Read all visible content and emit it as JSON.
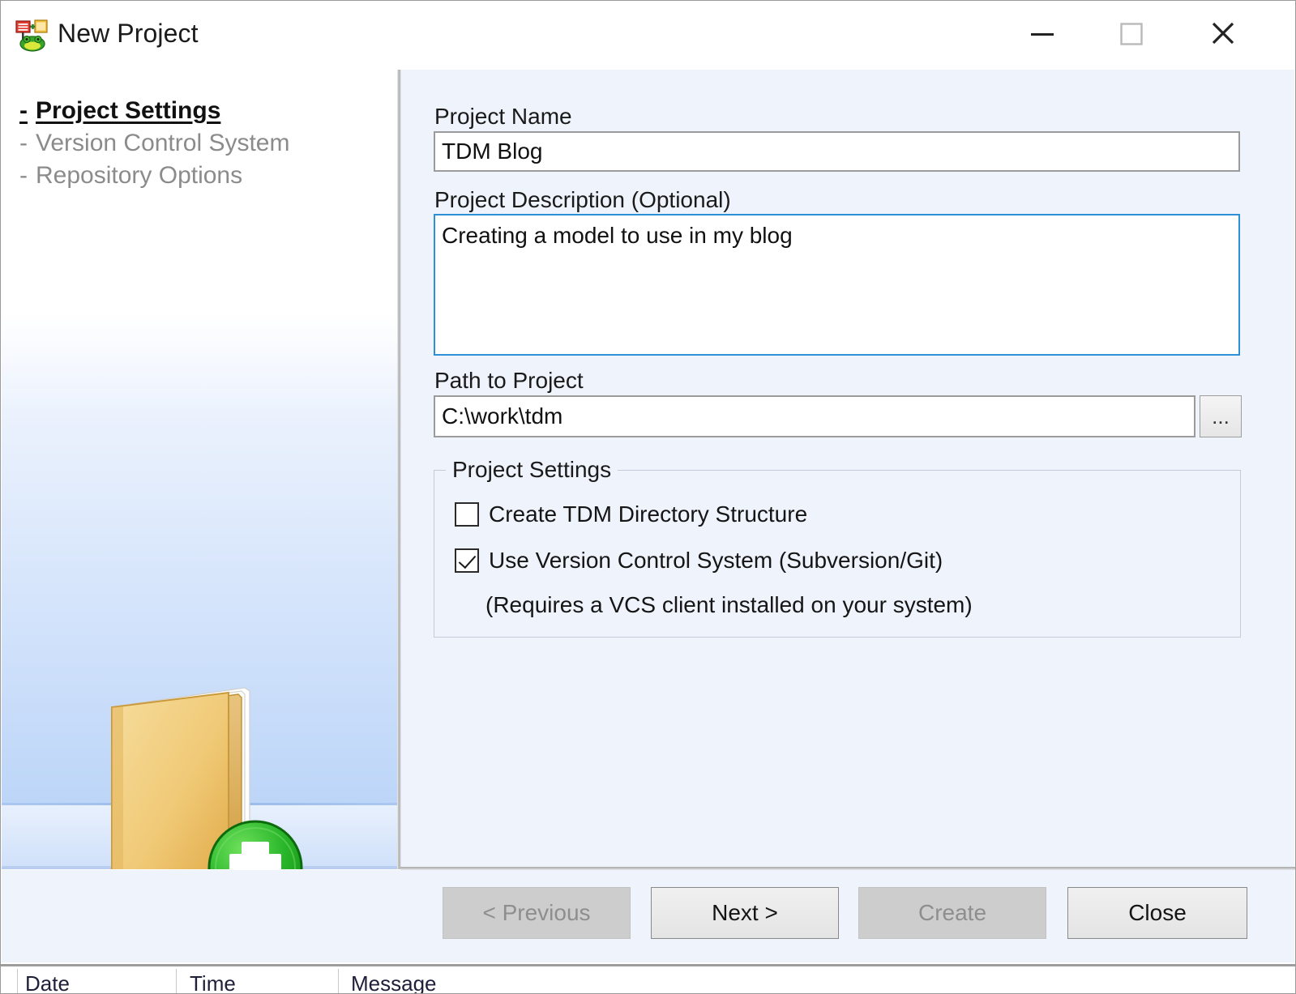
{
  "window": {
    "title": "New Project",
    "icon": "new-project-icon",
    "controls": {
      "minimize": "minimize-icon",
      "maximize": "maximize-icon",
      "close": "close-icon"
    }
  },
  "sidebar": {
    "items": [
      {
        "label": "- Project Settings",
        "dash": "-",
        "text": "Project Settings",
        "active": true
      },
      {
        "label": "- Version Control System",
        "dash": "-",
        "text": "Version Control System",
        "active": false
      },
      {
        "label": "- Repository Options",
        "dash": "-",
        "text": "Repository Options",
        "active": false
      }
    ],
    "illustration": "new-folder-icon"
  },
  "form": {
    "name_label": "Project Name",
    "name_value": "TDM Blog",
    "name_placeholder": "",
    "description_label": "Project Description (Optional)",
    "description_value": "Creating a model to use in my blog",
    "description_placeholder": "",
    "path_label": "Path to Project",
    "path_value": "C:\\work\\tdm",
    "path_placeholder": "",
    "browse_label": "...",
    "group": {
      "title": "Project Settings",
      "checkboxes": [
        {
          "label": "Create TDM Directory Structure",
          "checked": false
        },
        {
          "label": "Use Version Control System (Subversion/Git)",
          "checked": true
        }
      ],
      "note": "(Requires a VCS client installed on your system)"
    }
  },
  "footer": {
    "buttons": [
      {
        "label": "< Previous",
        "enabled": false
      },
      {
        "label": "Next >",
        "enabled": true
      },
      {
        "label": "Create",
        "enabled": false
      },
      {
        "label": "Close",
        "enabled": true
      }
    ]
  },
  "log_table": {
    "columns": [
      "Date",
      "Time",
      "Message"
    ]
  },
  "colors": {
    "pane_background": "#eef3fc",
    "focus_border": "#2d8fd5",
    "accent_green": "#2eb82e",
    "folder_yellow": "#f0c060",
    "disabled_text": "#8e8e8e"
  }
}
